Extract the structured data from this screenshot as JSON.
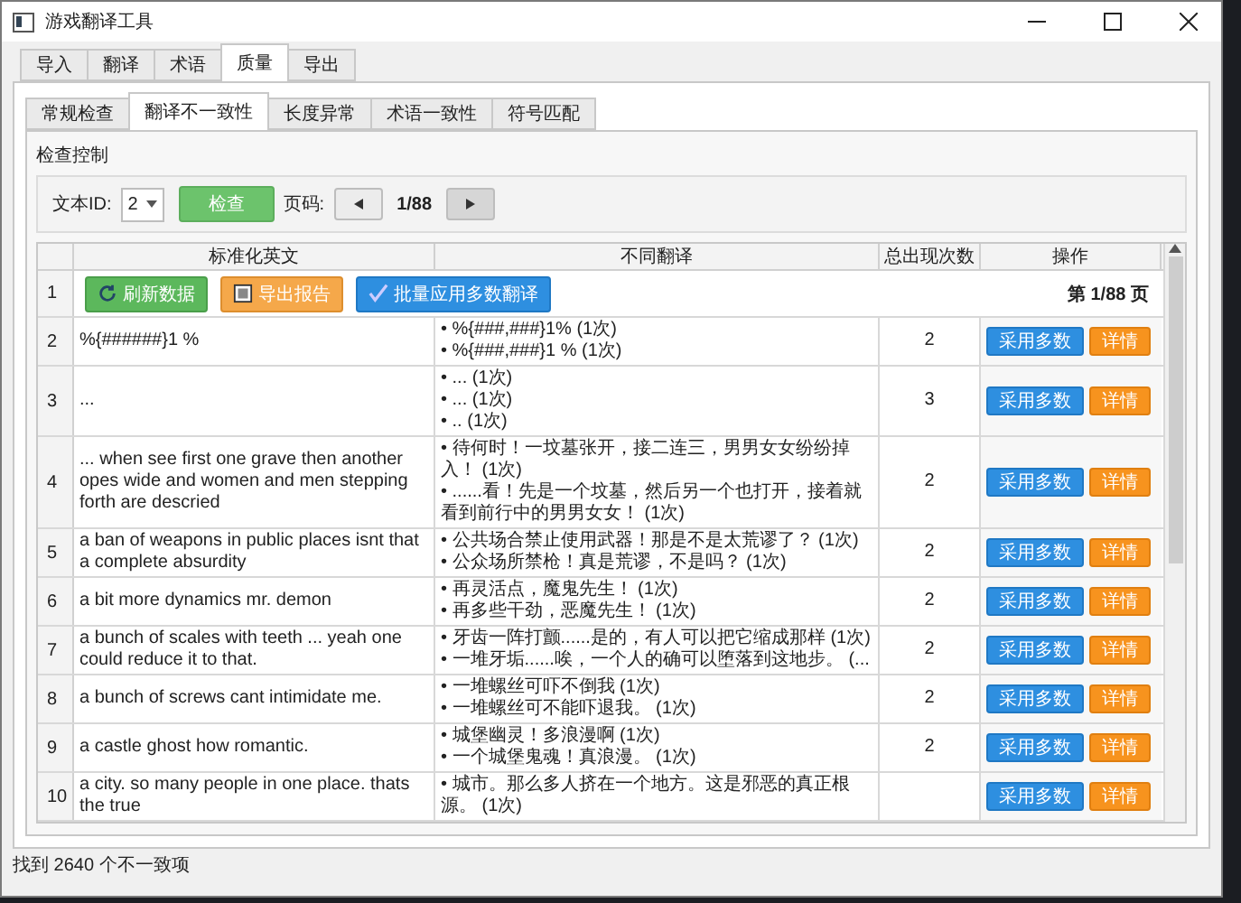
{
  "window": {
    "title": "游戏翻译工具"
  },
  "main_tabs": [
    {
      "label": "导入",
      "selected": false
    },
    {
      "label": "翻译",
      "selected": false
    },
    {
      "label": "术语",
      "selected": false
    },
    {
      "label": "质量",
      "selected": true
    },
    {
      "label": "导出",
      "selected": false
    }
  ],
  "sub_tabs": [
    {
      "label": "常规检查",
      "selected": false
    },
    {
      "label": "翻译不一致性",
      "selected": true
    },
    {
      "label": "长度异常",
      "selected": false
    },
    {
      "label": "术语一致性",
      "selected": false
    },
    {
      "label": "符号匹配",
      "selected": false
    }
  ],
  "control_group": {
    "title": "检查控制",
    "text_id_label": "文本ID:",
    "text_id_value": "2",
    "check_button": "检查",
    "page_label": "页码:",
    "page_reading": "1/88"
  },
  "table": {
    "columns": [
      "标准化英文",
      "不同翻译",
      "总出现次数",
      "操作"
    ],
    "toolbar_row": {
      "number": "1",
      "buttons": [
        {
          "label": "刷新数据",
          "kind": "refresh"
        },
        {
          "label": "导出报告",
          "kind": "export"
        },
        {
          "label": "批量应用多数翻译",
          "kind": "apply"
        }
      ],
      "page_info": "第 1/88 页"
    },
    "rows": [
      {
        "number": "2",
        "english": "%{######}1 %",
        "translations": [
          "• %{###,###}1% (1次)",
          "• %{###,###}1 % (1次)"
        ],
        "count": "2",
        "actions": [
          {
            "label": "采用多数",
            "kind": "adopt"
          },
          {
            "label": "详情",
            "kind": "detail"
          }
        ]
      },
      {
        "number": "3",
        "english": "...",
        "translations": [
          "• ... (1次)",
          "• ... (1次)",
          "• .. (1次)"
        ],
        "count": "3",
        "actions": [
          {
            "label": "采用多数",
            "kind": "adopt"
          },
          {
            "label": "详情",
            "kind": "detail"
          }
        ]
      },
      {
        "number": "4",
        "english": "... when see first one grave then another opes wide and women and men stepping forth are descried",
        "translations": [
          "• 待何时！一坟墓张开，接二连三，男男女女纷纷掉入！ (1次)",
          "• ......看！先是一个坟墓，然后另一个也打开，接着就看到前行中的男男女女！ (1次)"
        ],
        "count": "2",
        "actions": [
          {
            "label": "采用多数",
            "kind": "adopt"
          },
          {
            "label": "详情",
            "kind": "detail"
          }
        ]
      },
      {
        "number": "5",
        "english": "a ban of weapons in public places isnt that a complete absurdity",
        "translations": [
          "• 公共场合禁止使用武器！那是不是太荒谬了？ (1次)",
          "• 公众场所禁枪！真是荒谬，不是吗？ (1次)"
        ],
        "count": "2",
        "actions": [
          {
            "label": "采用多数",
            "kind": "adopt"
          },
          {
            "label": "详情",
            "kind": "detail"
          }
        ]
      },
      {
        "number": "6",
        "english": "a bit more dynamics mr. demon",
        "translations": [
          "• 再灵活点，魔鬼先生！ (1次)",
          "• 再多些干劲，恶魔先生！ (1次)"
        ],
        "count": "2",
        "actions": [
          {
            "label": "采用多数",
            "kind": "adopt"
          },
          {
            "label": "详情",
            "kind": "detail"
          }
        ]
      },
      {
        "number": "7",
        "english": "a bunch of scales with teeth ... yeah one could reduce it to that.",
        "translations": [
          "• 牙齿一阵打颤......是的，有人可以把它缩成那样 (1次)",
          "• 一堆牙垢......唉，一个人的确可以堕落到这地步。 (..."
        ],
        "count": "2",
        "actions": [
          {
            "label": "采用多数",
            "kind": "adopt"
          },
          {
            "label": "详情",
            "kind": "detail"
          }
        ]
      },
      {
        "number": "8",
        "english": "a bunch of screws cant intimidate me.",
        "translations": [
          "• 一堆螺丝可吓不倒我 (1次)",
          "• 一堆螺丝可不能吓退我。 (1次)"
        ],
        "count": "2",
        "actions": [
          {
            "label": "采用多数",
            "kind": "adopt"
          },
          {
            "label": "详情",
            "kind": "detail"
          }
        ]
      },
      {
        "number": "9",
        "english": "a castle ghost how romantic.",
        "translations": [
          "• 城堡幽灵！多浪漫啊 (1次)",
          "• 一个城堡鬼魂！真浪漫。 (1次)"
        ],
        "count": "2",
        "actions": [
          {
            "label": "采用多数",
            "kind": "adopt"
          },
          {
            "label": "详情",
            "kind": "detail"
          }
        ]
      },
      {
        "number": "10",
        "english": "a city. so many people in one place. thats the true",
        "translations": [
          "• 城市。那么多人挤在一个地方。这是邪恶的真正根源。 (1次)"
        ],
        "actions": [
          {
            "label": "采用多数",
            "kind": "adopt"
          },
          {
            "label": "详情",
            "kind": "detail"
          }
        ]
      }
    ]
  },
  "status_bar": "找到 2640 个不一致项"
}
